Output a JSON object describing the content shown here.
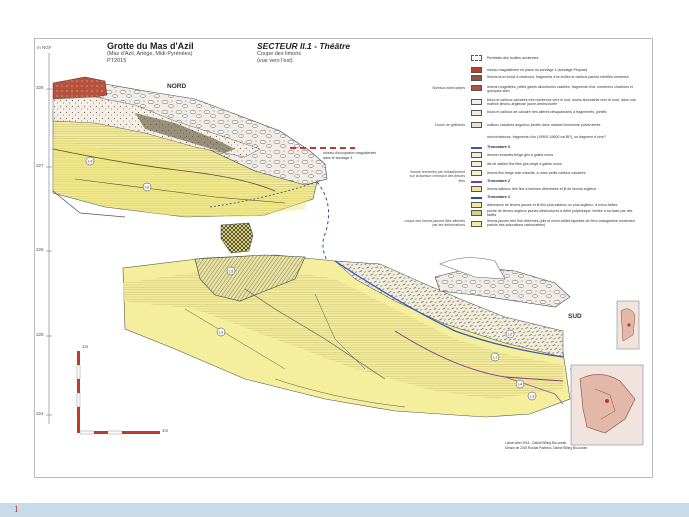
{
  "header": {
    "title": "Grotte du Mas d'Azil",
    "subtitle_1": "(Mas d'Azil, Ariège, Midi-Pyrénées)",
    "subtitle_2": "PT2015",
    "sector": "SECTEUR II.1 - Théâtre",
    "section_1": "Coupe des limons",
    "section_2": "(vue vers l'est)"
  },
  "orientation": {
    "north": "NORD",
    "south": "SUD"
  },
  "elevation": {
    "unit": "m NGF",
    "ticks": [
      "328",
      "327",
      "326",
      "325",
      "324"
    ]
  },
  "annotations": {
    "sampling_note_1": "niveau d'occupation magdalénien",
    "sampling_note_2": "dans le sondage 4",
    "layer_labels": [
      "L4",
      "L6",
      "L5",
      "L3",
      "L2",
      "L1",
      "L4",
      "L3"
    ]
  },
  "scale": {
    "vertical": "1m",
    "horizontal": "1m"
  },
  "legend": {
    "side_labels": {
      "anthropic": "Niveaux anthropisés",
      "falls": "Zones de gélifracts",
      "reworked": "limons remaniés par ruissellement sur la surface d'érosion des limons lités",
      "deformed": "coupe des limons jaunes lités affectés par les déformations"
    },
    "items": [
      "Remblais des fouilles anciennes",
      "niveau magdalénien en place du sondage 4 (sondage Péquart)",
      "limons brun foncé à charbons, fragments d'os brûlés et cailloux parfois rubéfiés remaniés",
      "limons rougeâtres, petits galets allochtones calcifiés, fragments d'os, nombreux charbons et quelques silex",
      "blocs et cailloux calcaires très nombreux vers le sud, moins abondants vers le nord, dans une matrice limono-argileuse jaune-destructurée",
      "blocs et cailloux de calcaire très altérés désquamants à fragmentés, jointifs",
      "cailloux calcaires anguleux jointifs dans matrice limoneuse pulvérulente",
      "microcharbons, fragments d'os (19900-19600 cal BP), un fragment d'ocre?",
      "Troncature 3",
      "limons remaniés beige gris à galets mous",
      "lits de sables fins lités gris beige à galets mous",
      "limons fins beige clair massifs, à rares petits cailloux calcaires",
      "Troncature 2",
      "limons sableux très fins à lamines déformées et lit de limons argileux",
      "Troncature 1",
      "alternance de limons jaunes et lit fins plus sableux ou plus argileux, à micro-failles",
      "poche de limons argileux jaunes déstructurés à débit polyédrique, limitée à sa base par des failles",
      "limons jaunes très fins déformés (plis et micro-failles tapissés de ferro-manganèse contenant parfois des indurations carbonatées)"
    ]
  },
  "credits": {
    "line_1": "Lobsin Abel 2015 - Dalhof Wiling Bio-ocean",
    "line_2": "Dessin de 2015 Rochat Pacheco, Dalhof Wiling Bio-ocean"
  },
  "bottom_mark": "1"
}
